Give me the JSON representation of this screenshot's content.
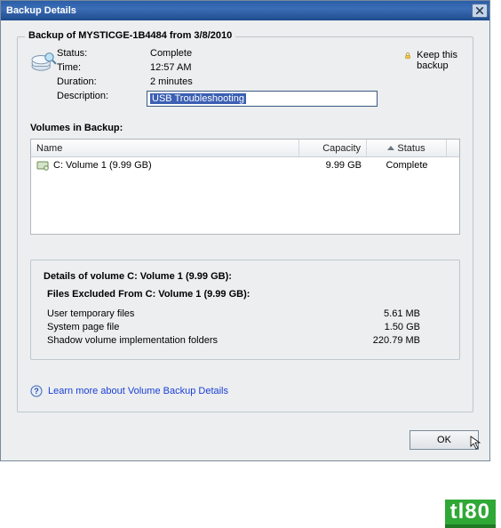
{
  "titlebar": {
    "title": "Backup Details"
  },
  "group": {
    "title": "Backup of MYSTICGE-1B4484 from 3/8/2010",
    "labels": {
      "status": "Status:",
      "time": "Time:",
      "duration": "Duration:",
      "description": "Description:"
    },
    "values": {
      "status": "Complete",
      "time": "12:57 AM",
      "duration": "2 minutes",
      "description": "USB Troubleshooting"
    },
    "keep_label": "Keep this backup"
  },
  "volumes": {
    "heading": "Volumes in Backup:",
    "headers": {
      "name": "Name",
      "capacity": "Capacity",
      "status": "Status"
    },
    "row": {
      "name": "C: Volume 1 (9.99 GB)",
      "capacity": "9.99 GB",
      "status": "Complete"
    }
  },
  "details": {
    "title": "Details of volume C: Volume 1 (9.99 GB):",
    "subtitle": "Files Excluded From C: Volume 1 (9.99 GB):",
    "items": {
      "tmp": {
        "name": "User temporary files",
        "size": "5.61 MB"
      },
      "page": {
        "name": "System page file",
        "size": "1.50 GB"
      },
      "shadow": {
        "name": "Shadow volume implementation folders",
        "size": "220.79 MB"
      }
    }
  },
  "link_text": "Learn more about Volume Backup Details",
  "ok_label": "OK",
  "watermark": "tl80"
}
